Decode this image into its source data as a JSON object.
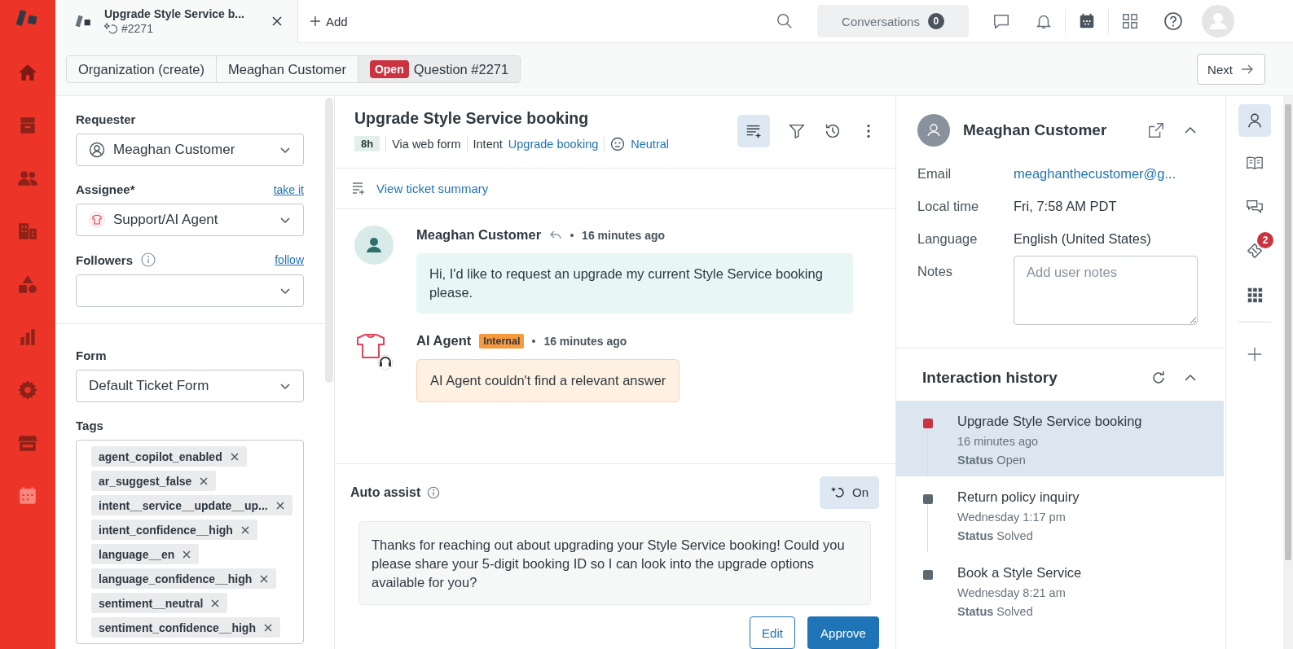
{
  "tabs": [
    {
      "title": "Upgrade Style Service b...",
      "subtitle": "#2271"
    }
  ],
  "add_tab": "Add",
  "conversations": {
    "label": "Conversations",
    "count": "0"
  },
  "breadcrumbs": [
    {
      "label": "Organization (create)",
      "selected": false
    },
    {
      "label": "Meaghan Customer",
      "selected": false
    },
    {
      "badge": "Open",
      "label": "Question #2271",
      "selected": true
    }
  ],
  "next_button": "Next",
  "properties": {
    "requester": {
      "label": "Requester",
      "value": "Meaghan Customer"
    },
    "assignee": {
      "label": "Assignee*",
      "link": "take it",
      "value": "Support/AI Agent"
    },
    "followers": {
      "label": "Followers",
      "link": "follow"
    },
    "form": {
      "label": "Form",
      "value": "Default Ticket Form"
    },
    "tags": {
      "label": "Tags",
      "items": [
        "agent_copilot_enabled",
        "ar_suggest_false",
        "intent__service__update__up...",
        "intent_confidence__high",
        "language__en",
        "language_confidence__high",
        "sentiment__neutral",
        "sentiment_confidence__high"
      ]
    }
  },
  "ticket": {
    "title": "Upgrade Style Service booking",
    "sla": "8h",
    "channel": "Via web form",
    "intent_label": "Intent",
    "intent": "Upgrade booking",
    "sentiment": "Neutral",
    "summary_link": "View ticket summary"
  },
  "messages": [
    {
      "kind": "customer",
      "author": "Meaghan Customer",
      "time": "16 minutes ago",
      "body": "Hi, I'd like to request an upgrade my current Style Service booking please."
    },
    {
      "kind": "ai",
      "author": "AI Agent",
      "badge": "Internal",
      "time": "16 minutes ago",
      "body": "AI Agent couldn't find a relevant answer"
    }
  ],
  "auto_assist": {
    "title": "Auto assist",
    "toggle": "On",
    "on": true,
    "suggestion": "Thanks for reaching out about upgrading your Style Service booking! Could you please share your 5-digit booking ID so I can look into the upgrade options available for you?",
    "buttons": [
      "Edit",
      "Approve"
    ]
  },
  "customer": {
    "name": "Meaghan Customer",
    "fields": [
      {
        "label": "Email",
        "value": "meaghanthecustomer@g...",
        "kind": "link"
      },
      {
        "label": "Local time",
        "value": "Fri, 7:58 AM PDT",
        "kind": "text"
      },
      {
        "label": "Language",
        "value": "English (United States)",
        "kind": "text"
      }
    ],
    "notes": {
      "label": "Notes",
      "placeholder": "Add user notes"
    }
  },
  "history": {
    "title": "Interaction history",
    "items": [
      {
        "title": "Upgrade Style Service booking",
        "time": "16 minutes ago",
        "status": "**Status** Open",
        "color": "#cc3340",
        "selected": true
      },
      {
        "title": "Return policy inquiry",
        "time": "Wednesday 1:17 pm",
        "status": "**Status** Solved",
        "color": "#5c6970",
        "selected": false
      },
      {
        "title": "Book a Style Service",
        "time": "Wednesday 8:21 am",
        "status": "**Status** Solved",
        "color": "#5c6970",
        "selected": false
      }
    ]
  },
  "rail_badge": "2"
}
